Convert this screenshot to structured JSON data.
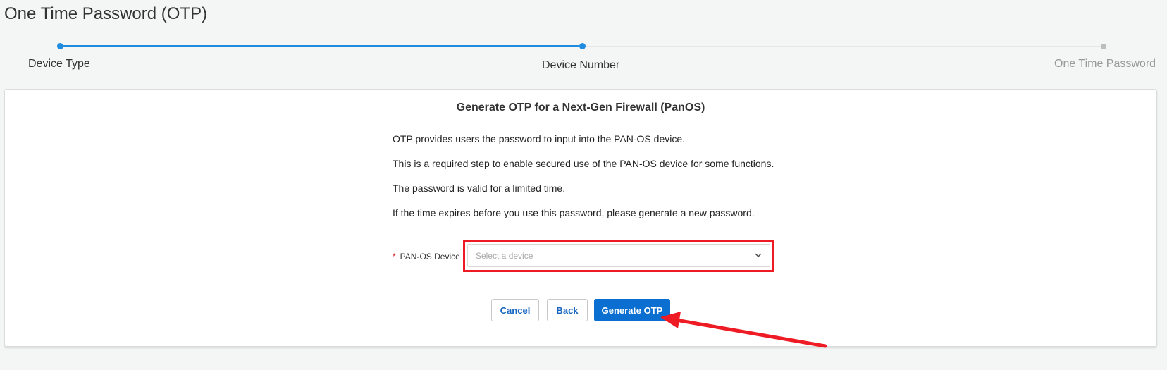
{
  "page": {
    "title": "One Time Password (OTP)"
  },
  "stepper": {
    "steps": [
      {
        "label": "Device Type",
        "state": "completed"
      },
      {
        "label": "Device Number",
        "state": "current"
      },
      {
        "label": "One Time Password",
        "state": "pending"
      }
    ]
  },
  "card": {
    "title": "Generate OTP for a Next-Gen Firewall (PanOS)",
    "paragraphs": [
      "OTP provides users the password to input into the PAN-OS device.",
      "This is a required step to enable secured use of the PAN-OS device for some functions.",
      "The password is valid for a limited time.",
      "If the time expires before you use this password, please generate a new password."
    ],
    "device_field": {
      "required_marker": "*",
      "label": "PAN-OS Device :",
      "placeholder": "Select a device",
      "value": ""
    },
    "buttons": {
      "cancel": "Cancel",
      "back": "Back",
      "generate": "Generate OTP"
    }
  },
  "colors": {
    "accent": "#1f8ce0",
    "primary_button": "#0a6fd1",
    "annotation_red": "#ee1b24",
    "required": "#d8262c"
  },
  "icons": {
    "select_chevron": "chevron-down-icon"
  }
}
